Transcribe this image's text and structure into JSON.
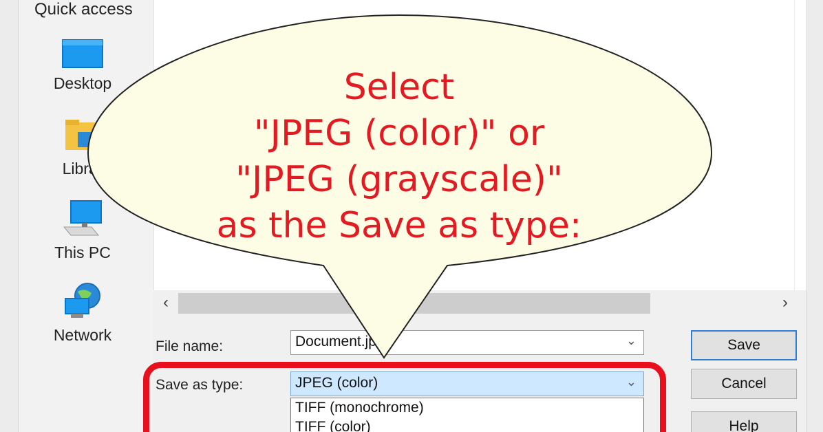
{
  "nav": {
    "quick_access": "Quick access",
    "items": [
      {
        "label": "Desktop",
        "icon": "desktop-icon"
      },
      {
        "label": "Librar",
        "icon": "libraries-icon"
      },
      {
        "label": "This PC",
        "icon": "this-pc-icon"
      },
      {
        "label": "Network",
        "icon": "network-icon"
      }
    ]
  },
  "scroll": {
    "left_arrow": "‹",
    "right_arrow": "›"
  },
  "form": {
    "file_name_label": "File name:",
    "file_name_value": "Document.jp",
    "save_as_type_label": "Save as type:",
    "save_as_type_value": "JPEG (color)",
    "type_options": [
      "TIFF (monochrome)",
      "TIFF (color)"
    ]
  },
  "buttons": {
    "save": "Save",
    "cancel": "Cancel",
    "help": "Help"
  },
  "callout": {
    "lines": [
      "Select",
      "\"JPEG (color)\" or",
      "\"JPEG (grayscale)\"",
      "as the Save as type:"
    ],
    "text_color": "#e21a22",
    "fill_color": "#fdfde6"
  },
  "highlight_color": "#e8101c"
}
